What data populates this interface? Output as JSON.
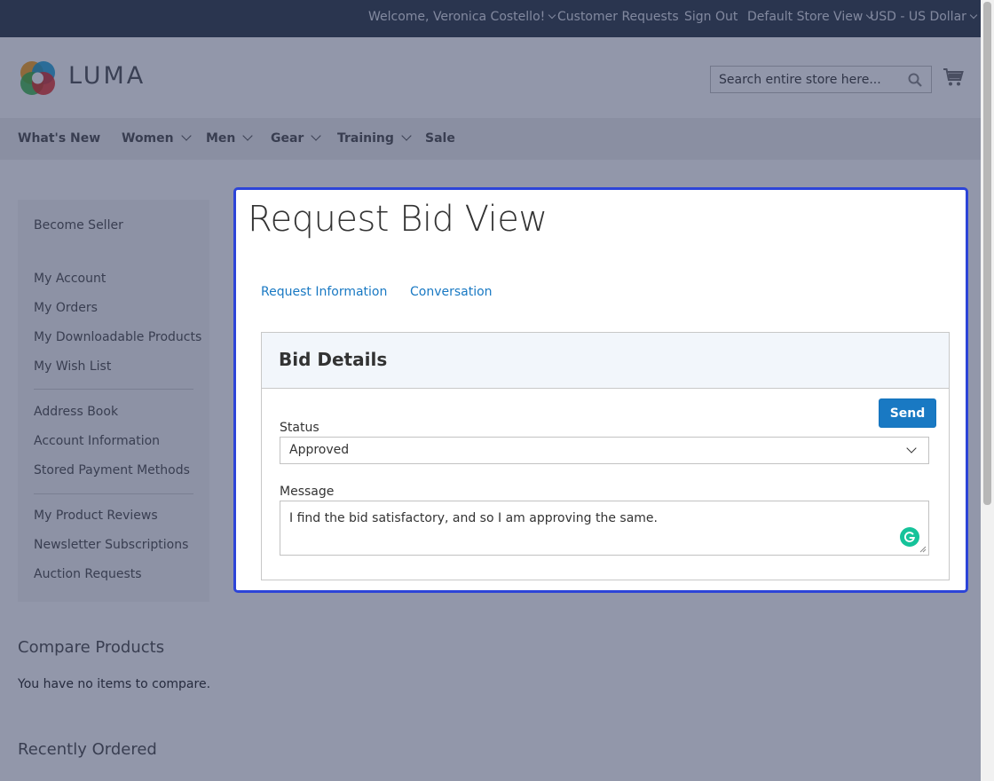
{
  "topbar": {
    "welcome": "Welcome, Veronica Costello!",
    "customer_requests": "Customer Requests",
    "sign_out": "Sign Out",
    "store_view": "Default Store View",
    "currency": "USD - US Dollar"
  },
  "header": {
    "logo_text": "LUMA",
    "search_placeholder": "Search entire store here..."
  },
  "nav": {
    "items": [
      "What's New",
      "Women",
      "Men",
      "Gear",
      "Training",
      "Sale"
    ]
  },
  "sidebar": {
    "become_seller": "Become Seller",
    "group1": [
      "My Account",
      "My Orders",
      "My Downloadable Products",
      "My Wish List"
    ],
    "group2": [
      "Address Book",
      "Account Information",
      "Stored Payment Methods"
    ],
    "group3": [
      "My Product Reviews",
      "Newsletter Subscriptions",
      "Auction Requests"
    ]
  },
  "compare": {
    "title": "Compare Products",
    "empty_text": "You have no items to compare."
  },
  "recent": {
    "title": "Recently Ordered"
  },
  "main": {
    "title": "Request Bid View",
    "tabs": [
      "Request Information",
      "Conversation"
    ],
    "panel_title": "Bid Details",
    "send_label": "Send",
    "status_label": "Status",
    "status_value": "Approved",
    "message_label": "Message",
    "message_value": "I find the bid satisfactory, and so I am approving the same."
  },
  "colors": {
    "accent": "#1979c3",
    "focus_outline": "#2c44d8",
    "topbar": "#3c4654"
  }
}
